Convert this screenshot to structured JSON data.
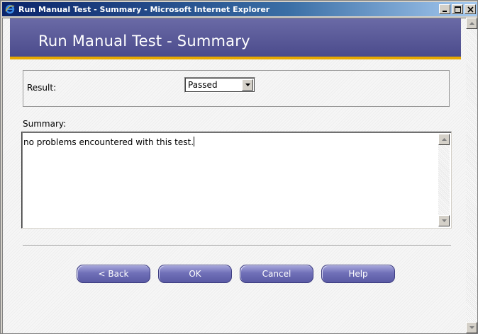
{
  "window": {
    "title": "Run Manual Test - Summary - Microsoft Internet Explorer",
    "minimize_label": "_",
    "maximize_label": "□",
    "close_label": "×"
  },
  "header": {
    "title": "Run Manual Test - Summary"
  },
  "result": {
    "label": "Result:",
    "selected": "Passed"
  },
  "summary": {
    "label": "Summary:",
    "text": "no problems encountered with this test."
  },
  "buttons": {
    "back": "< Back",
    "ok": "OK",
    "cancel": "Cancel",
    "help": "Help"
  },
  "icons": {
    "app": "ie-icon",
    "dropdown": "chevron-down-icon",
    "scroll_up": "scroll-up-icon",
    "scroll_down": "scroll-down-icon"
  },
  "colors": {
    "titlebar": "#0a246a",
    "header_banner": "#4b4b8c",
    "header_accent": "#e8a800",
    "button": "#6a6ab0"
  }
}
